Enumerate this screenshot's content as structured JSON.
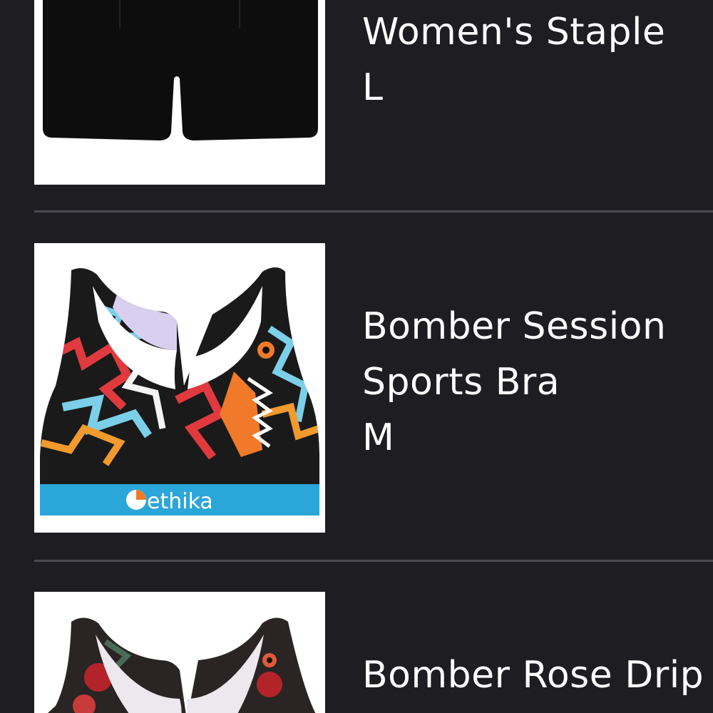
{
  "items": [
    {
      "name_line1": "Women's Staple",
      "size": "L",
      "thumbnail": "black-shorts"
    },
    {
      "name_line1": "Bomber Session",
      "name_line2": "Sports Bra",
      "size": "M",
      "thumbnail": "graffiti-sports-bra",
      "brand_logo_text": "ethika"
    },
    {
      "name_line1": "Bomber Rose Drip",
      "thumbnail": "rose-sports-bra"
    }
  ],
  "colors": {
    "background": "#1e1e22",
    "divider": "#4a4a50",
    "text": "#ffffff",
    "band_blue": "#2aa6d8"
  }
}
